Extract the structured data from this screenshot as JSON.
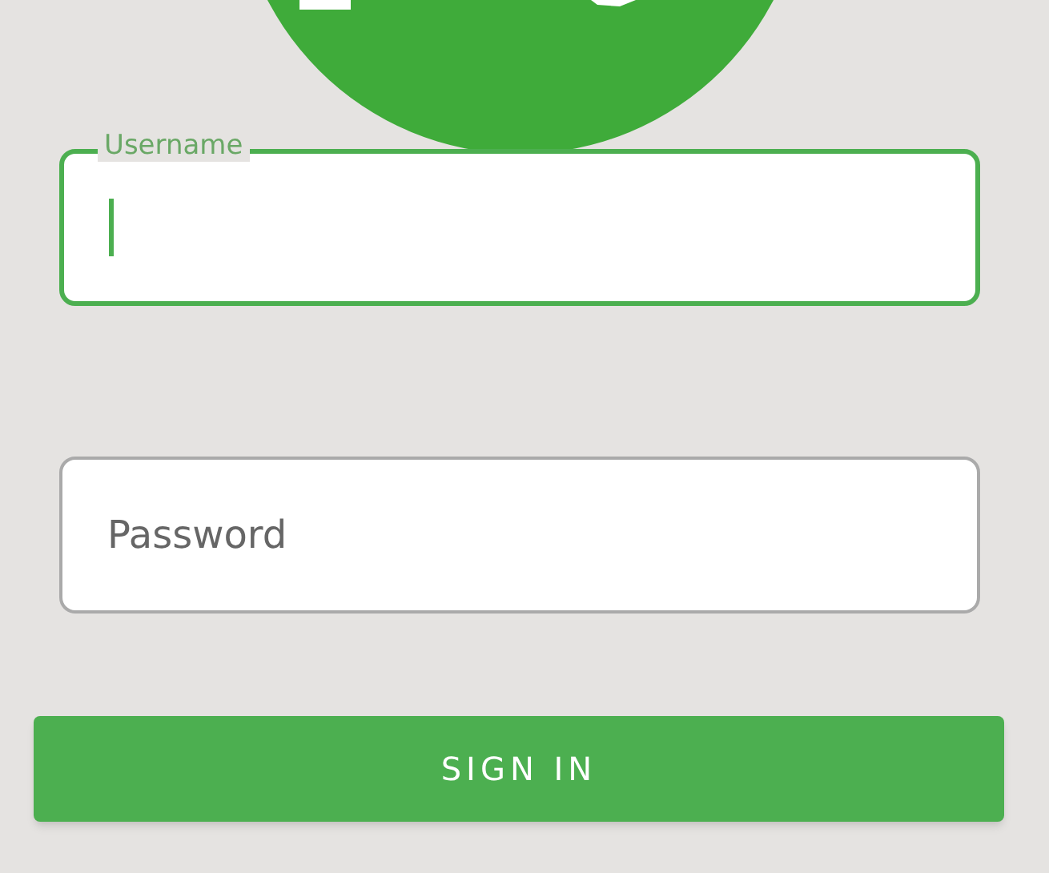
{
  "fields": [
    {
      "label": "Username",
      "focused": true
    },
    {
      "placeholder": "Password",
      "focused": false
    }
  ],
  "sign_in_button": {
    "label": "SIGN IN"
  }
}
